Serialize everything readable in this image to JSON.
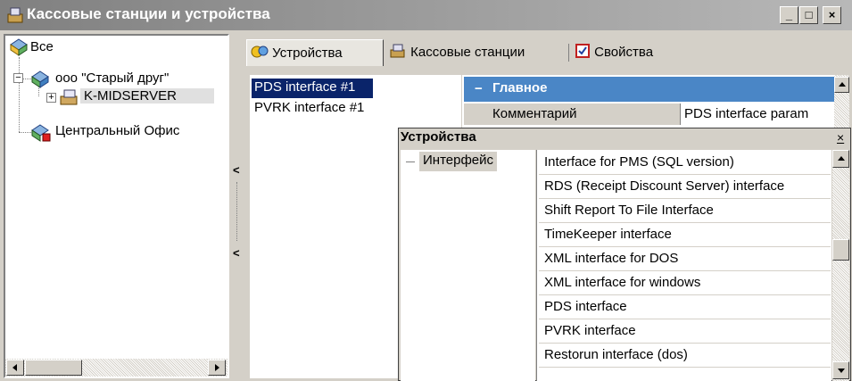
{
  "window": {
    "title": "Кассовые станции и устройства",
    "min_btn": "_",
    "max_btn": "□",
    "close_btn": "×"
  },
  "tree": {
    "root": "Все",
    "org": "ооо \"Старый друг\"",
    "server": "K-MIDSERVER",
    "office": "Центральный Офис",
    "expander_minus": "−",
    "expander_plus": "+"
  },
  "tabs": [
    {
      "label": "Устройства",
      "icon": "devices-icon"
    },
    {
      "label": "Кассовые станции",
      "icon": "cash-stations-icon"
    },
    {
      "label": "Свойства",
      "icon": "properties-icon"
    }
  ],
  "device_list": [
    "PDS interface #1",
    "PVRK interface #1"
  ],
  "properties": {
    "section": "Главное",
    "collapse": "−",
    "row_name": "Комментарий",
    "row_value": "PDS interface param"
  },
  "popup": {
    "title": "Устройства",
    "close": "×",
    "category": "Интерфейс",
    "items": [
      "Interface for PMS (SQL version)",
      "RDS (Receipt Discount Server) interface",
      "Shift Report To File Interface",
      "TimeKeeper interface",
      "XML interface for DOS",
      "XML interface for windows",
      "PDS interface",
      "PVRK interface",
      "Restorun interface (dos)"
    ]
  },
  "splitter_arrows": [
    "<",
    "<"
  ],
  "colors": {
    "selection": "#0a246a",
    "header_blue": "#4a86c6",
    "titlebar": "#808080"
  }
}
